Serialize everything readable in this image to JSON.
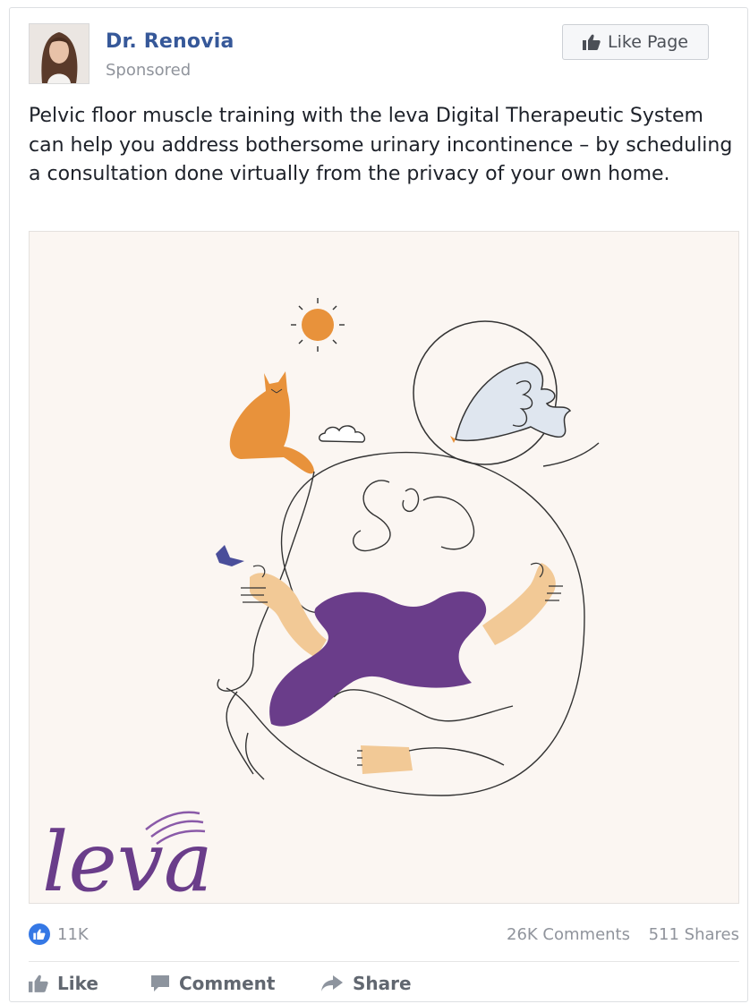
{
  "post": {
    "page_name": "Dr. Renovia",
    "sponsored_label": "Sponsored",
    "like_page_label": "Like Page",
    "text": "Pelvic floor muscle training with the leva Digital Therapeutic System can help you address bothersome urinary incontinence – by scheduling a consultation done virtually from the privacy of your own home.",
    "image_logo_text": "leva"
  },
  "reactions": {
    "likes": "11K",
    "comments": "26K Comments",
    "shares": "511 Shares"
  },
  "actions": {
    "like": "Like",
    "comment": "Comment",
    "share": "Share"
  },
  "colors": {
    "brand_blue": "#365899",
    "like_blue": "#3578e5",
    "illustration_purple": "#6a3d8a",
    "illustration_orange": "#e8923b",
    "image_bg": "#fbf6f2"
  }
}
